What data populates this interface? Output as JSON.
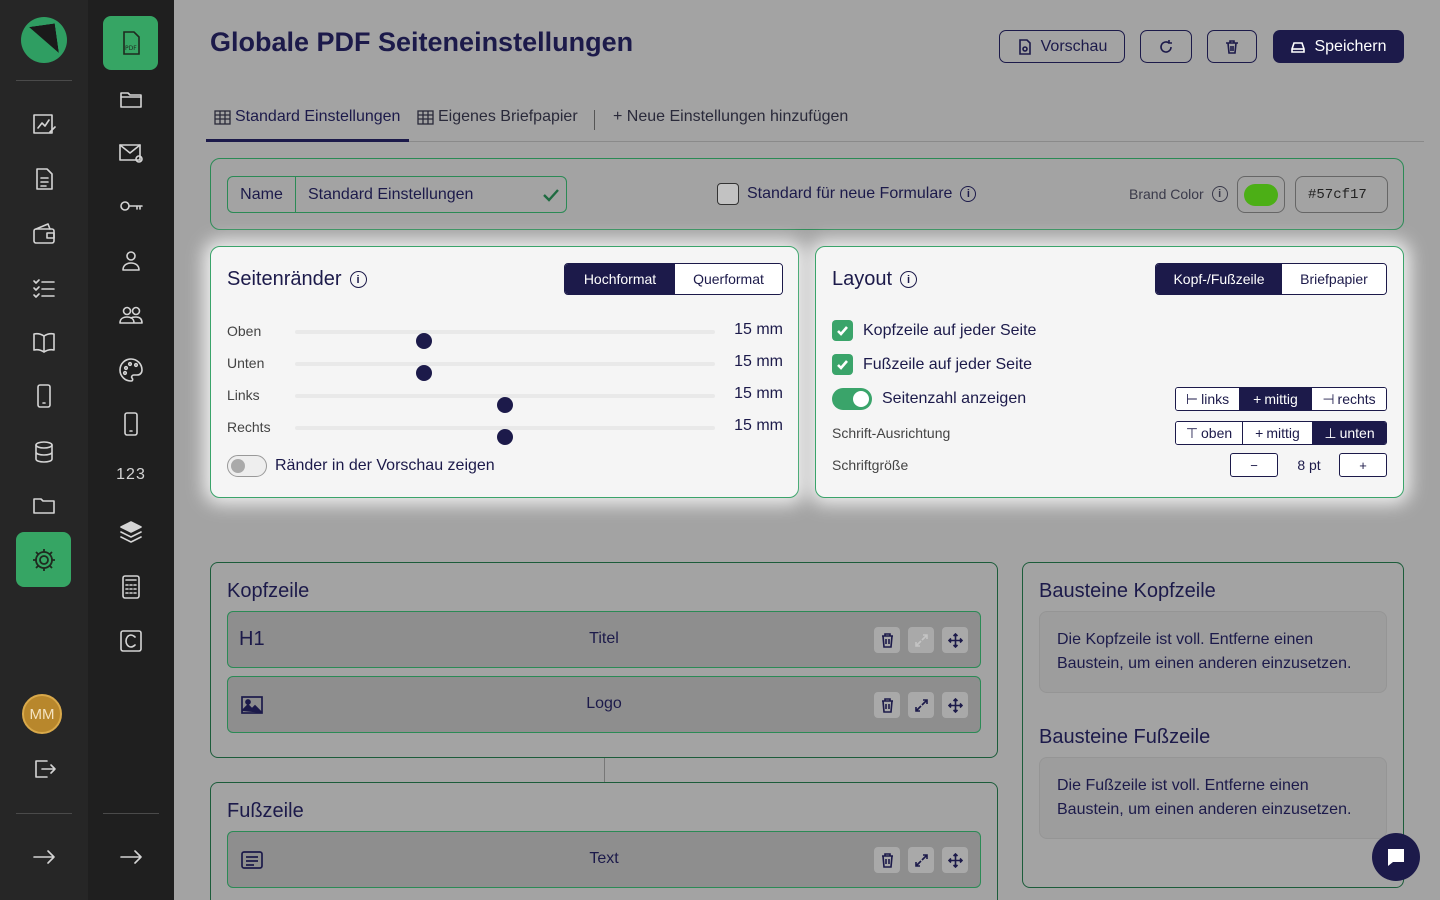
{
  "sidebar": {
    "avatar_initials": "MM",
    "rail2_numeric_label": "123"
  },
  "header": {
    "title": "Globale PDF Seiteneinstellungen",
    "preview_label": "Vorschau",
    "save_label": "Speichern"
  },
  "tabs": [
    {
      "label": "Standard Einstellungen",
      "active": true
    },
    {
      "label": "Eigenes Briefpapier",
      "active": false
    },
    {
      "label": "+ Neue Einstellungen hinzufügen",
      "active": false
    }
  ],
  "settings": {
    "name_label": "Name",
    "name_value": "Standard Einstellungen",
    "default_checkbox_label": "Standard für neue Formulare",
    "default_checked": false,
    "brand_color_label": "Brand Color",
    "brand_color_hex": "#57cf17",
    "brand_color_swatch": "#4caf16"
  },
  "margins": {
    "title": "Seitenränder",
    "orientation_options": [
      "Hochformat",
      "Querformat"
    ],
    "orientation_selected": "Hochformat",
    "rows": [
      {
        "label": "Oben",
        "value": "15 mm",
        "position": 0.307
      },
      {
        "label": "Unten",
        "value": "15 mm",
        "position": 0.307
      },
      {
        "label": "Links",
        "value": "15 mm",
        "position": 0.5
      },
      {
        "label": "Rechts",
        "value": "15 mm",
        "position": 0.5
      }
    ],
    "show_margins_label": "Ränder in der Vorschau zeigen",
    "show_margins_on": false
  },
  "layout": {
    "title": "Layout",
    "mode_options": [
      "Kopf-/Fußzeile",
      "Briefpapier"
    ],
    "mode_selected": "Kopf-/Fußzeile",
    "header_every_page_label": "Kopfzeile auf jeder Seite",
    "footer_every_page_label": "Fußzeile auf jeder Seite",
    "page_number_label": "Seitenzahl anzeigen",
    "page_number_on": true,
    "h_align_options": [
      "links",
      "mittig",
      "rechts"
    ],
    "h_align_selected": "mittig",
    "font_align_label": "Schrift-Ausrichtung",
    "v_align_options": [
      "oben",
      "mittig",
      "unten"
    ],
    "v_align_selected": "unten",
    "font_size_label": "Schriftgröße",
    "font_size_value": "8 pt",
    "decrement_label": "−",
    "increment_label": "+"
  },
  "header_section": {
    "title": "Kopfzeile",
    "blocks": [
      {
        "icon_text": "H1",
        "label": "Titel"
      },
      {
        "icon_text": "",
        "label": "Logo"
      }
    ]
  },
  "footer_section": {
    "title": "Fußzeile",
    "blocks": [
      {
        "label": "Text"
      }
    ]
  },
  "side": {
    "header_blocks_title": "Bausteine Kopfzeile",
    "header_blocks_text": "Die Kopfzeile ist voll. Entferne einen Baustein, um einen anderen einzusetzen.",
    "footer_blocks_title": "Bausteine Fußzeile",
    "footer_blocks_text": "Die Fußzeile ist voll. Entferne einen Baustein, um einen anderen einzusetzen."
  }
}
